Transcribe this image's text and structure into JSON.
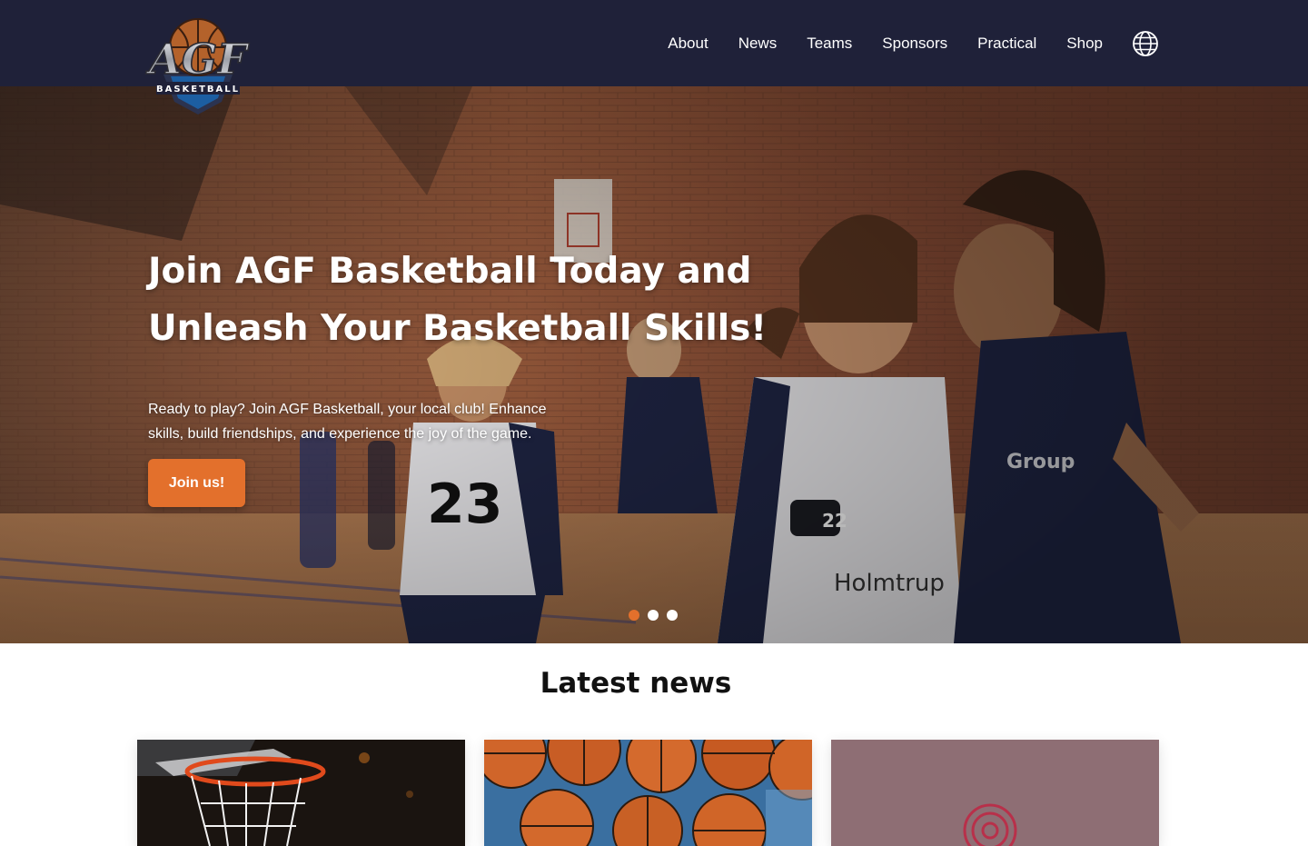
{
  "header": {
    "logo_text": "AGF",
    "logo_subtext": "BASKETBALL",
    "nav": [
      "About",
      "News",
      "Teams",
      "Sponsors",
      "Practical",
      "Shop"
    ],
    "language_icon": "globe-icon"
  },
  "hero": {
    "title": "Join AGF Basketball Today and Unleash Your Basketball Skills!",
    "subtitle": "Ready to play? Join AGF Basketball, your local club! Enhance skills, build friendships, and experience the joy of the game.",
    "cta": "Join us!",
    "slides": 3,
    "active_slide": 1
  },
  "news": {
    "title": "Latest news",
    "cards": [
      "basketball-hoop-image",
      "basketballs-image",
      "club-logo-placeholder"
    ]
  },
  "colors": {
    "header_bg": "#1f2139",
    "accent": "#e3702c",
    "card_placeholder": "#8e6e74"
  }
}
